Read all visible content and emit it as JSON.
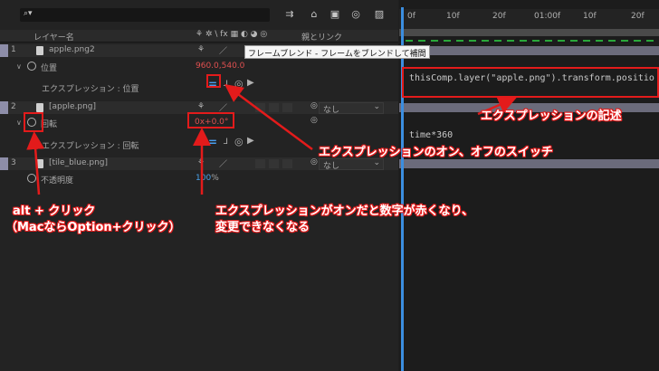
{
  "header": {
    "layer_name": "レイヤー名",
    "parent_link": "親とリンク",
    "search_icon": "search-icon"
  },
  "ruler": {
    "ticks": [
      "0f",
      "10f",
      "20f",
      "01:00f",
      "10f",
      "20f"
    ]
  },
  "tooltip": "フレームブレンド - フレームをブレンドして補間",
  "layers": [
    {
      "num": "1",
      "name": "apple.png2"
    },
    {
      "num": "2",
      "name": "[apple.png]",
      "parent": "なし"
    },
    {
      "num": "3",
      "name": "[tile_blue.png]",
      "parent": "なし"
    }
  ],
  "props": {
    "position_label": "位置",
    "position_value": "960.0,540.0",
    "expr_position_label": "エクスプレッション : 位置",
    "rotation_label": "回転",
    "rotation_value": "0x+0.0°",
    "expr_rotation_label": "エクスプレッション : 回転",
    "opacity_label": "不透明度",
    "opacity_value": "100",
    "opacity_unit": "%"
  },
  "expressions": {
    "position_code": "thisComp.layer(\"apple.png\").transform.positio",
    "rotation_code": "time*360"
  },
  "annotations": {
    "expr_write": "エクスプレッションの記述",
    "expr_switch": "エクスプレッションのオン、オフのスイッチ",
    "alt_click_1": "alt + クリック",
    "alt_click_2": "（MacならOption+クリック）",
    "red_digits_1": "エクスプレッションがオンだと数字が赤くなり、",
    "red_digits_2": "変更できなくなる"
  },
  "colors": {
    "annotation_red": "#e31b1b",
    "expression_value_red": "#e05050",
    "playhead_blue": "#3b8ee0",
    "work_bar_green": "#2aa83a"
  }
}
